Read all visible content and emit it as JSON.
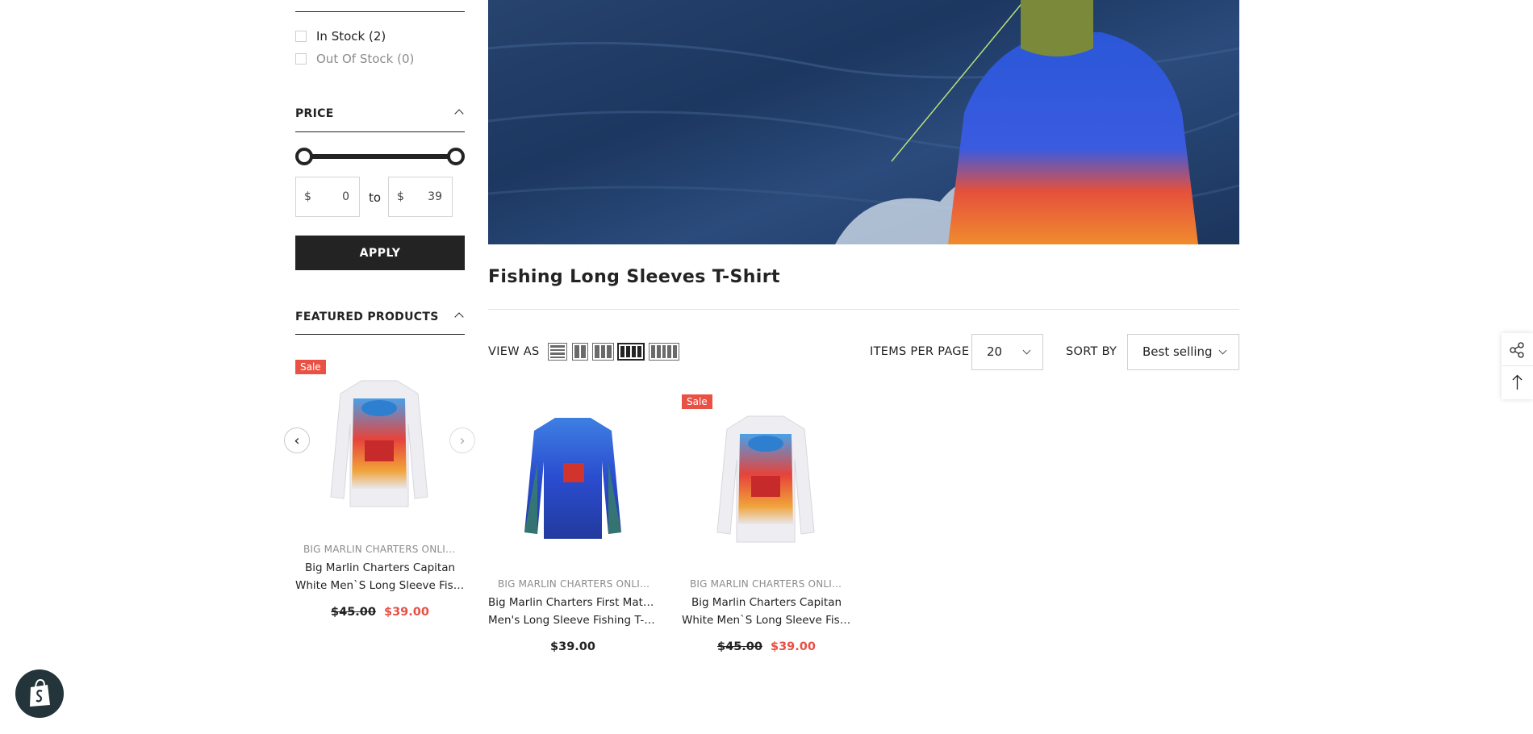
{
  "sidebar": {
    "availability": [
      {
        "label": "In Stock (2)"
      },
      {
        "label": "Out Of Stock (0)"
      }
    ],
    "price": {
      "heading": "PRICE",
      "currency": "$",
      "min_value": "0",
      "max_value": "39",
      "to_label": "to",
      "apply_label": "APPLY"
    },
    "featured": {
      "heading": "FEATURED PRODUCTS",
      "product": {
        "badge": "Sale",
        "vendor": "BIG MARLIN CHARTERS ONLINE STORE",
        "title_line1": "Big Marlin Charters Capitan",
        "title_line2": "White Men`S Long Sleeve Fishing T-Shirt",
        "old_price": "$45.00",
        "price": "$39.00"
      }
    }
  },
  "collection": {
    "title": "Fishing Long Sleeves T-Shirt",
    "toolbar": {
      "view_as_label": "VIEW AS",
      "items_per_page_label": "ITEMS PER PAGE",
      "items_per_page_value": "20",
      "sort_by_label": "SORT BY",
      "sort_by_value": "Best selling"
    },
    "products": [
      {
        "badge": "",
        "vendor": "BIG MARLIN CHARTERS ONLINE STORE",
        "title_line1": "Big Marlin Charters First Mate Azul",
        "title_line2": "Men's Long Sleeve Fishing T-Shirt",
        "price": "$39.00"
      },
      {
        "badge": "Sale",
        "vendor": "BIG MARLIN CHARTERS ONLINE STORE",
        "title_line1": "Big Marlin Charters Capitan",
        "title_line2": "White Men`S Long Sleeve Fishing T-Shirt",
        "old_price": "$45.00",
        "price": "$39.00"
      }
    ]
  },
  "colors": {
    "accent": "#e95144",
    "dark": "#232323"
  },
  "icons": [
    "share-icon",
    "arrow-up-icon",
    "shopify-bag-icon",
    "chevron-left-icon",
    "chevron-right-icon"
  ]
}
